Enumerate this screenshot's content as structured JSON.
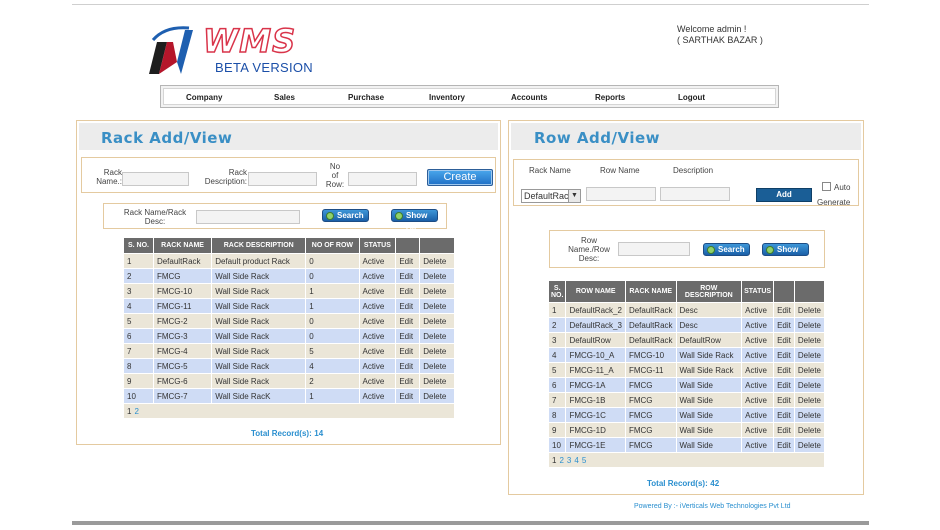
{
  "header": {
    "logo_text": "WMS",
    "logo_sub": "BETA VERSION",
    "welcome_line1": "Welcome admin !",
    "welcome_line2": "( SARTHAK BAZAR )"
  },
  "nav": {
    "items": [
      "Company",
      "Sales",
      "Purchase",
      "Inventory",
      "Accounts",
      "Reports",
      "Logout"
    ]
  },
  "rack": {
    "title": "Rack Add/View",
    "form": {
      "name_label_1": "Rack",
      "name_label_2": "Name.:",
      "desc_label_1": "Rack",
      "desc_label_2": "Description:",
      "row_label_1": "No",
      "row_label_2": "of",
      "row_label_3": "Row:",
      "create_label": "Create",
      "name_value": "",
      "desc_value": "",
      "row_value": ""
    },
    "search": {
      "label_1": "Rack Name/Rack",
      "label_2": "Desc:",
      "value": "",
      "search_label": "Search",
      "showall_label": "Show All"
    },
    "table": {
      "headers": [
        "S. NO.",
        "RACK NAME",
        "RACK DESCRIPTION",
        "NO OF ROW",
        "STATUS"
      ],
      "rows": [
        [
          "1",
          "DefaultRack",
          "Default product Rack",
          "0",
          "Active"
        ],
        [
          "2",
          "FMCG",
          "Wall Side Rack",
          "0",
          "Active"
        ],
        [
          "3",
          "FMCG-10",
          "Wall Side Rack",
          "1",
          "Active"
        ],
        [
          "4",
          "FMCG-11",
          "Wall Side Rack",
          "1",
          "Active"
        ],
        [
          "5",
          "FMCG-2",
          "Wall Side Rack",
          "0",
          "Active"
        ],
        [
          "6",
          "FMCG-3",
          "Wall Side Rack",
          "0",
          "Active"
        ],
        [
          "7",
          "FMCG-4",
          "Wall Side Rack",
          "5",
          "Active"
        ],
        [
          "8",
          "FMCG-5",
          "Wall Side Rack",
          "4",
          "Active"
        ],
        [
          "9",
          "FMCG-6",
          "Wall Side Rack",
          "2",
          "Active"
        ],
        [
          "10",
          "FMCG-7",
          "Wall Side RacK",
          "1",
          "Active"
        ]
      ],
      "edit_label": "Edit",
      "delete_label": "Delete",
      "pages": [
        "1",
        "2"
      ]
    },
    "total_label": "Total Record(s):",
    "total_value": "14"
  },
  "row": {
    "title": "Row Add/View",
    "form": {
      "rack_label": "Rack Name",
      "row_label": "Row Name",
      "desc_label": "Description",
      "rack_selected": "DefaultRack",
      "row_value": "",
      "desc_value": "",
      "add_label": "Add",
      "auto_label": "Auto",
      "generate_label": "Generate"
    },
    "search": {
      "label_1": "Row",
      "label_2": "Name./Row",
      "label_3": "Desc:",
      "value": "",
      "search_label": "Search",
      "showall_label": "Show All"
    },
    "table": {
      "headers_1": [
        "S.",
        "ROW NAME",
        "RACK NAME",
        "ROW DESCRIPTION",
        "STATUS"
      ],
      "headers_2": [
        "NO."
      ],
      "rows": [
        [
          "1",
          "DefaultRack_2",
          "DefaultRack",
          "Desc",
          "Active"
        ],
        [
          "2",
          "DefaultRack_3",
          "DefaultRack",
          "Desc",
          "Active"
        ],
        [
          "3",
          "DefaultRow",
          "DefaultRack",
          "DefaultRow",
          "Active"
        ],
        [
          "4",
          "FMCG-10_A",
          "FMCG-10",
          "Wall Side Rack",
          "Active"
        ],
        [
          "5",
          "FMCG-11_A",
          "FMCG-11",
          "Wall Side Rack",
          "Active"
        ],
        [
          "6",
          "FMCG-1A",
          "FMCG",
          "Wall Side",
          "Active"
        ],
        [
          "7",
          "FMCG-1B",
          "FMCG",
          "Wall Side",
          "Active"
        ],
        [
          "8",
          "FMCG-1C",
          "FMCG",
          "Wall Side",
          "Active"
        ],
        [
          "9",
          "FMCG-1D",
          "FMCG",
          "Wall Side",
          "Active"
        ],
        [
          "10",
          "FMCG-1E",
          "FMCG",
          "Wall Side",
          "Active"
        ]
      ],
      "edit_label": "Edit",
      "delete_label": "Delete",
      "pages": [
        "1",
        "2",
        "3",
        "4",
        "5"
      ]
    },
    "total_label": "Total Record(s):",
    "total_value": "42"
  },
  "footer": {
    "powered": "Powered By :- iVerticals Web Technologies Pvt Ltd"
  },
  "colors": {
    "accent": "#3a8fc5",
    "link": "#2a8fcf",
    "panel_border": "#e4caa0",
    "header_row": "#6b6b6b"
  }
}
